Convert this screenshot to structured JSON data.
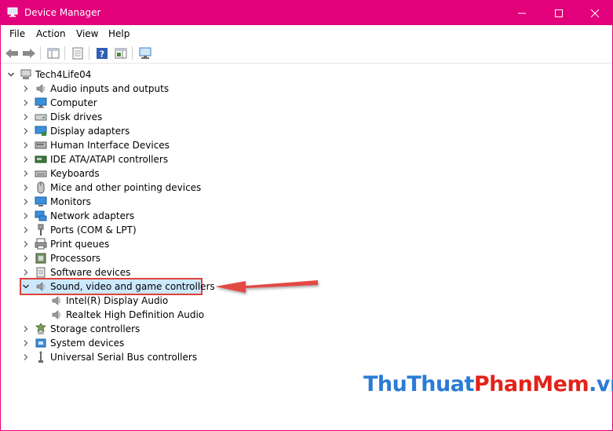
{
  "window": {
    "title": "Device Manager",
    "accent_color": "#e3007b"
  },
  "menu": [
    "File",
    "Action",
    "View",
    "Help"
  ],
  "toolbar": {
    "icons": [
      "back-arrow-icon",
      "forward-arrow-icon",
      "console-tree-icon",
      "properties-icon",
      "help-icon",
      "action-pane-icon",
      "scan-hardware-icon"
    ]
  },
  "tree": {
    "root": "Tech4Life04",
    "categories": [
      {
        "label": "Audio inputs and outputs",
        "icon": "speaker-icon",
        "expanded": false
      },
      {
        "label": "Computer",
        "icon": "computer-icon",
        "expanded": false
      },
      {
        "label": "Disk drives",
        "icon": "disk-drive-icon",
        "expanded": false
      },
      {
        "label": "Display adapters",
        "icon": "display-adapter-icon",
        "expanded": false
      },
      {
        "label": "Human Interface Devices",
        "icon": "hid-icon",
        "expanded": false
      },
      {
        "label": "IDE ATA/ATAPI controllers",
        "icon": "ide-controller-icon",
        "expanded": false
      },
      {
        "label": "Keyboards",
        "icon": "keyboard-icon",
        "expanded": false
      },
      {
        "label": "Mice and other pointing devices",
        "icon": "mouse-icon",
        "expanded": false
      },
      {
        "label": "Monitors",
        "icon": "monitor-icon",
        "expanded": false
      },
      {
        "label": "Network adapters",
        "icon": "network-adapter-icon",
        "expanded": false
      },
      {
        "label": "Ports (COM & LPT)",
        "icon": "port-icon",
        "expanded": false
      },
      {
        "label": "Print queues",
        "icon": "printer-icon",
        "expanded": false
      },
      {
        "label": "Processors",
        "icon": "processor-icon",
        "expanded": false
      },
      {
        "label": "Software devices",
        "icon": "software-device-icon",
        "expanded": false
      },
      {
        "label": "Sound, video and game controllers",
        "icon": "speaker-icon",
        "expanded": true,
        "children": [
          "Intel(R) Display Audio",
          "Realtek High Definition Audio"
        ]
      },
      {
        "label": "Storage controllers",
        "icon": "storage-controller-icon",
        "expanded": false
      },
      {
        "label": "System devices",
        "icon": "system-device-icon",
        "expanded": false
      },
      {
        "label": "Universal Serial Bus controllers",
        "icon": "usb-icon",
        "expanded": false
      }
    ]
  },
  "annotation": {
    "highlight_color": "#e0403a"
  },
  "watermark": {
    "part1": "ThuThuat",
    "part2": "PhanMem",
    "part3": ".vn"
  }
}
